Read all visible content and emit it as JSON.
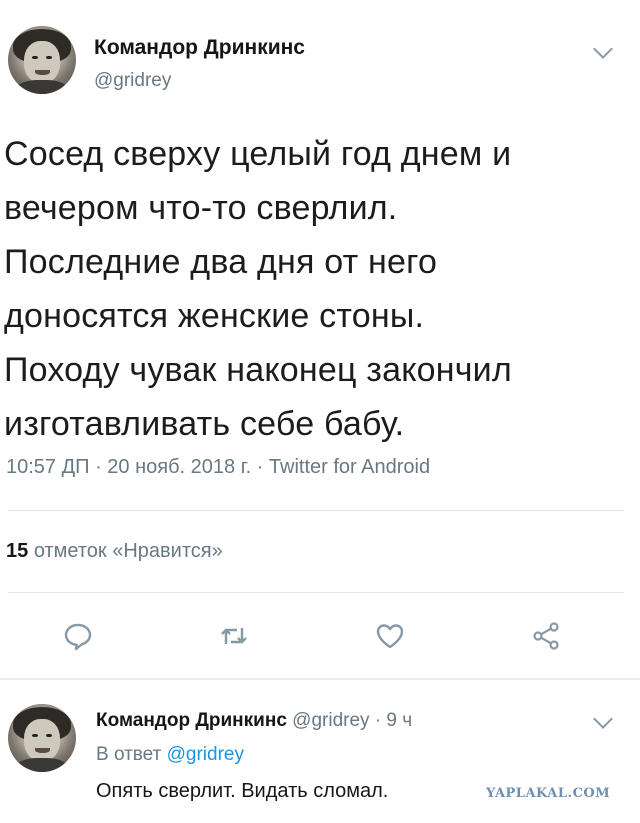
{
  "tweet": {
    "author_name": "Командор Дринкинс",
    "handle": "@gridrey",
    "text_lines": [
      "Сосед сверху целый год днем и",
      "вечером что-то сверлил.",
      "Последние два дня от него",
      "доносятся женские стоны.",
      "Походу чувак наконец закончил",
      "изготавливать себе бабу."
    ],
    "meta": "10:57 ДП · 20 нояб. 2018 г. · Twitter for Android",
    "likes_count": "15",
    "likes_label": "отметок «Нравится»",
    "actions": [
      {
        "name": "reply",
        "icon": "speech-bubble-icon"
      },
      {
        "name": "retweet",
        "icon": "retweet-icon"
      },
      {
        "name": "like",
        "icon": "heart-icon"
      },
      {
        "name": "share",
        "icon": "share-icon"
      }
    ]
  },
  "reply": {
    "author_name": "Командор Дринкинс",
    "handle_time": "@gridrey · 9 ч",
    "reply_prefix": "В ответ",
    "reply_to_handle": "@gridrey",
    "text": "Опять сверлит. Видать сломал."
  },
  "watermark": "YAPLAKAL.COM",
  "colors": {
    "link": "#1b95e0",
    "muted": "#697882",
    "icon": "#8899a6"
  }
}
